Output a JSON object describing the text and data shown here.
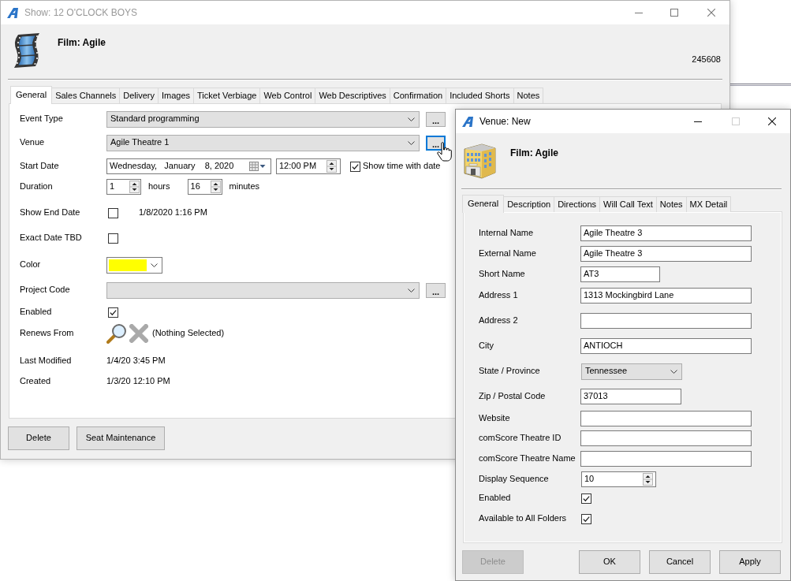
{
  "show_window": {
    "title": "Show: 12 O'CLOCK BOYS",
    "active": false,
    "maximize_enabled": true,
    "header": {
      "title": "Film: Agile",
      "record_number": "245608"
    },
    "tabs": [
      {
        "label": "General",
        "selected": true
      },
      {
        "label": "Sales Channels",
        "selected": false
      },
      {
        "label": "Delivery",
        "selected": false
      },
      {
        "label": "Images",
        "selected": false
      },
      {
        "label": "Ticket Verbiage",
        "selected": false
      },
      {
        "label": "Web Control",
        "selected": false
      },
      {
        "label": "Web Descriptives",
        "selected": false
      },
      {
        "label": "Confirmation",
        "selected": false
      },
      {
        "label": "Included Shorts",
        "selected": false
      },
      {
        "label": "Notes",
        "selected": false
      }
    ],
    "fields": [
      {
        "kind": "combo",
        "label": "Event Type",
        "value": "Standard programming",
        "button": {
          "label": "...",
          "focused": false
        }
      },
      {
        "kind": "combo",
        "label": "Venue",
        "value": "Agile Theatre 1",
        "button": {
          "label": "...",
          "focused": true
        }
      },
      {
        "kind": "datetime",
        "label": "Start Date",
        "date": "Wednesday,   January    8, 2020",
        "time": "12:00 PM",
        "option": {
          "label": "Show time with date",
          "checked": true
        }
      },
      {
        "kind": "duration",
        "label": "Duration",
        "hours": "1",
        "hours_unit": "hours",
        "minutes": "16",
        "minutes_unit": "minutes"
      },
      {
        "kind": "checkbox",
        "label": "Show End Date",
        "checked": false,
        "note": "1/8/2020 1:16 PM"
      },
      {
        "kind": "checkbox",
        "label": "Exact Date TBD",
        "checked": false
      },
      {
        "kind": "color",
        "label": "Color",
        "color": "#ffff00"
      },
      {
        "kind": "combo",
        "label": "Project Code",
        "button": {
          "label": "...",
          "focused": false
        }
      },
      {
        "kind": "checkbox",
        "label": "Enabled",
        "checked": true
      },
      {
        "kind": "lookup",
        "label": "Renews From",
        "value": "(Nothing Selected)"
      },
      {
        "kind": "text",
        "label": "Last Modified",
        "value": "1/4/20 3:45 PM"
      },
      {
        "kind": "text",
        "label": "Created",
        "value": "1/3/20 12:10 PM"
      }
    ],
    "buttons": [
      {
        "label": "Delete",
        "disabled": false
      },
      {
        "label": "Seat Maintenance",
        "disabled": false
      }
    ]
  },
  "venue_window": {
    "title": "Venue: New",
    "active": true,
    "maximize_enabled": false,
    "header": {
      "title": "Film: Agile"
    },
    "tabs": [
      {
        "label": "General",
        "selected": true
      },
      {
        "label": "Description",
        "selected": false
      },
      {
        "label": "Directions",
        "selected": false
      },
      {
        "label": "Will Call Text",
        "selected": false
      },
      {
        "label": "Notes",
        "selected": false
      },
      {
        "label": "MX Detail",
        "selected": false
      }
    ],
    "fields": [
      {
        "kind": "text",
        "label": "Internal Name",
        "value": "Agile Theatre 3"
      },
      {
        "kind": "text",
        "label": "External Name",
        "value": "Agile Theatre 3"
      },
      {
        "kind": "short_text",
        "label": "Short Name",
        "value": "AT3"
      },
      {
        "kind": "text",
        "label": "Address 1",
        "value": "1313 Mockingbird Lane"
      },
      {
        "kind": "text",
        "label": "Address 2"
      },
      {
        "kind": "text",
        "label": "City",
        "value": "ANTIOCH"
      },
      {
        "kind": "select",
        "label": "State / Province",
        "value": "Tennessee"
      },
      {
        "kind": "medium_text",
        "label": "Zip / Postal Code",
        "value": "37013"
      },
      {
        "kind": "text",
        "label": "Website"
      },
      {
        "kind": "text",
        "label": "comScore Theatre ID"
      },
      {
        "kind": "text",
        "label": "comScore Theatre Name"
      },
      {
        "kind": "spin",
        "label": "Display Sequence",
        "value": "10"
      },
      {
        "kind": "checkbox",
        "label": "Enabled",
        "checked": true
      },
      {
        "kind": "checkbox",
        "label": "Available to All Folders",
        "checked": true
      }
    ],
    "buttons": [
      {
        "label": "Delete",
        "disabled": true
      },
      {
        "label": "OK",
        "disabled": false
      },
      {
        "label": "Cancel",
        "disabled": false
      },
      {
        "label": "Apply",
        "disabled": false
      }
    ]
  }
}
